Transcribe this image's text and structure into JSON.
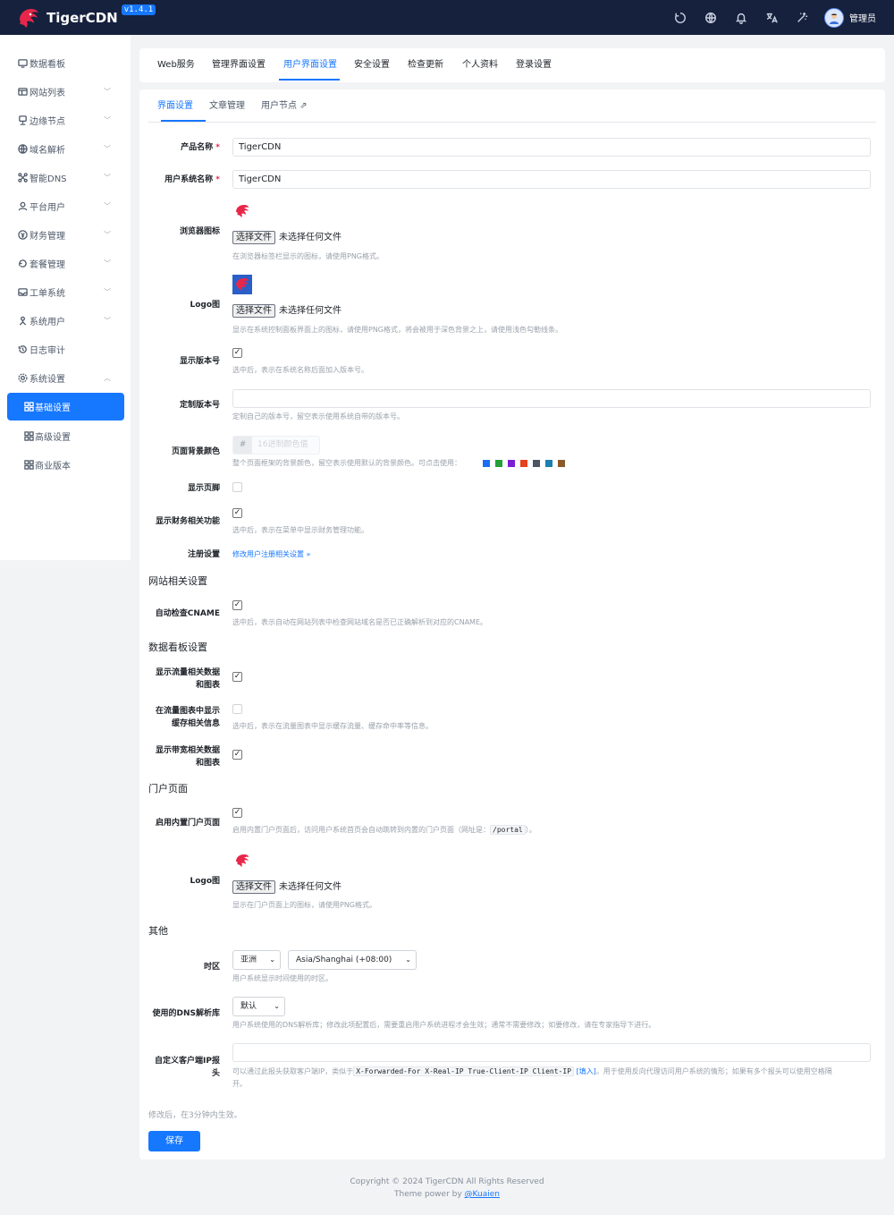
{
  "app": {
    "name": "TigerCDN",
    "version": "v1.4.1",
    "user": "管理员"
  },
  "topbar_icons": [
    "refresh-icon",
    "globe-icon",
    "bell-icon",
    "translate-icon",
    "theme-icon"
  ],
  "sidebar": {
    "items": [
      {
        "label": "数据看板",
        "icon": "dashboard-icon"
      },
      {
        "label": "网站列表",
        "icon": "website-icon"
      },
      {
        "label": "边缘节点",
        "icon": "node-icon"
      },
      {
        "label": "域名解析",
        "icon": "dns-globe-icon"
      },
      {
        "label": "智能DNS",
        "icon": "smart-dns-icon"
      },
      {
        "label": "平台用户",
        "icon": "user-icon"
      },
      {
        "label": "财务管理",
        "icon": "finance-icon"
      },
      {
        "label": "套餐管理",
        "icon": "package-icon"
      },
      {
        "label": "工单系统",
        "icon": "ticket-icon"
      },
      {
        "label": "系统用户",
        "icon": "system-user-icon"
      },
      {
        "label": "日志审计",
        "icon": "log-icon"
      },
      {
        "label": "系统设置",
        "icon": "settings-icon"
      }
    ],
    "sub_items": [
      {
        "label": "基础设置"
      },
      {
        "label": "高级设置"
      },
      {
        "label": "商业版本"
      }
    ]
  },
  "tabs": [
    "Web服务",
    "管理界面设置",
    "用户界面设置",
    "安全设置",
    "检查更新",
    "个人资料",
    "登录设置"
  ],
  "subtabs": [
    "界面设置",
    "文章管理",
    "用户节点"
  ],
  "form": {
    "product_name": {
      "label": "产品名称",
      "value": "TigerCDN"
    },
    "system_name": {
      "label": "用户系统名称",
      "value": "TigerCDN"
    },
    "required_mark": "*",
    "favicon": {
      "label": "浏览器图标",
      "button": "选择文件",
      "status": "未选择任何文件",
      "hint": "在浏览器标签栏显示的图标，请使用PNG格式。"
    },
    "logo": {
      "label": "Logo图",
      "button": "选择文件",
      "status": "未选择任何文件",
      "hint": "显示在系统控制面板界面上的图标，请使用PNG格式，将会被用于深色背景之上，请使用浅色勾勒线条。"
    },
    "show_version": {
      "label": "显示版本号",
      "checked": true,
      "hint": "选中后，表示在系统名称后面加入版本号。"
    },
    "custom_version": {
      "label": "定制版本号",
      "value": "",
      "hint": "定制自己的版本号，留空表示使用系统自带的版本号。"
    },
    "bg_color": {
      "label": "页面背景颜色",
      "prefix": "#",
      "placeholder": "16进制颜色值",
      "hint": "整个页面框架的背景颜色，留空表示使用默认的背景颜色。可点击使用：",
      "swatches": [
        "#1b6ef3",
        "#21a137",
        "#7a1fd6",
        "#e8411e",
        "#4b5563",
        "#1b7fb0",
        "#8b5a2b"
      ]
    },
    "show_footer": {
      "label": "显示页脚",
      "checked": false
    },
    "show_finance": {
      "label": "显示财务相关功能",
      "checked": true,
      "hint": "选中后，表示在菜单中显示财务管理功能。"
    },
    "register": {
      "label": "注册设置",
      "link": "修改用户注册相关设置 »"
    },
    "website_section": "网站相关设置",
    "auto_cname": {
      "label": "自动检查CNAME",
      "checked": true,
      "hint": "选中后，表示自动在网站列表中检查网站域名是否已正确解析到对应的CNAME。"
    },
    "dashboard_section": "数据看板设置",
    "show_traffic": {
      "label1": "显示流量相关数据",
      "label2": "和图表",
      "checked": true
    },
    "show_cache": {
      "label1": "在流量图表中显示",
      "label2": "缓存相关信息",
      "checked": false,
      "hint": "选中后，表示在流量图表中显示缓存流量、缓存命中率等信息。"
    },
    "show_bandwidth": {
      "label1": "显示带宽相关数据",
      "label2": "和图表",
      "checked": true
    },
    "portal_section": "门户页面",
    "portal_enable": {
      "label": "启用内置门户页面",
      "checked": true,
      "hint_prefix": "启用内置门户页面后，访问用户系统首页会自动跳转到内置的门户页面（网址是：",
      "hint_code": "/portal",
      "hint_suffix": "）。"
    },
    "portal_logo": {
      "label": "Logo图",
      "button": "选择文件",
      "status": "未选择任何文件",
      "hint": "显示在门户页面上的图标，请使用PNG格式。"
    },
    "other_section": "其他",
    "timezone": {
      "label": "时区",
      "region": "亚洲",
      "zone": "Asia/Shanghai (+08:00)",
      "hint": "用户系统显示时间使用的时区。"
    },
    "dns_resolver": {
      "label": "使用的DNS解析库",
      "value": "默认",
      "hint": "用户系统使用的DNS解析库；修改此项配置后，需要重启用户系统进程才会生效；通常不需要修改；如要修改，请在专家指导下进行。"
    },
    "client_ip": {
      "label1": "自定义客户端IP报",
      "label2": "头",
      "value": "",
      "hint_prefix": "可以通过此报头获取客户端IP，类似于",
      "hint_code": "X-Forwarded-For X-Real-IP True-Client-IP Client-IP",
      "hint_link": "[填入]",
      "hint_suffix": "。用于使用反向代理访问用户系统的情形；如果有多个报头可以使用空格隔",
      "hint_line2": "开。"
    },
    "note": "修改后，在3分钟内生效。",
    "save": "保存"
  },
  "footer": {
    "copyright": "Copyright © 2024 TigerCDN All Rights Reserved",
    "theme_prefix": "Theme power by ",
    "theme_link": "@Kuaien"
  }
}
